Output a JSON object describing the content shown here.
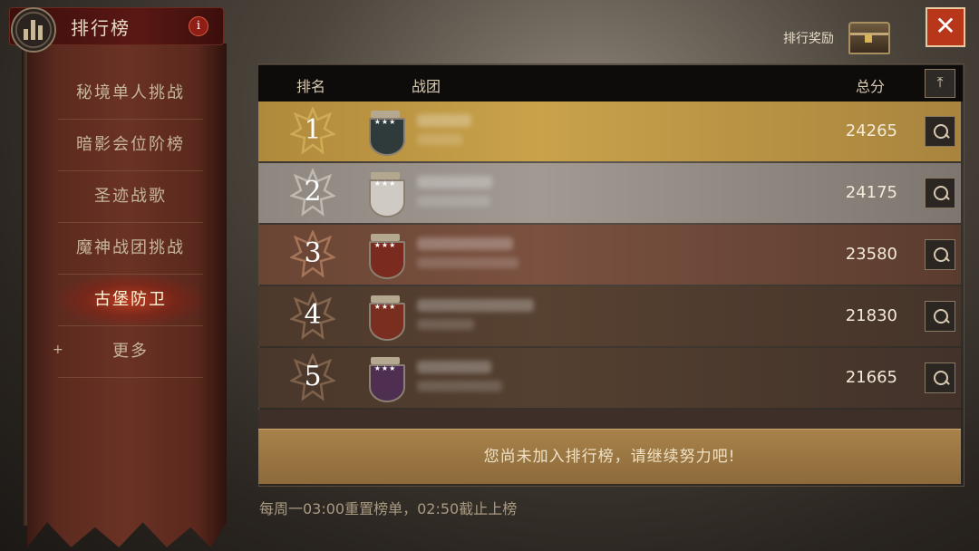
{
  "header": {
    "title": "排行榜",
    "info_icon": "i"
  },
  "sidebar": {
    "items": [
      {
        "label": "秘境单人挑战",
        "active": false
      },
      {
        "label": "暗影会位阶榜",
        "active": false
      },
      {
        "label": "圣迹战歌",
        "active": false
      },
      {
        "label": "魔神战团挑战",
        "active": false
      },
      {
        "label": "古堡防卫",
        "active": true
      },
      {
        "label": "更多",
        "active": false
      }
    ],
    "more_icon": "+"
  },
  "rewards": {
    "label": "排行奖励"
  },
  "close_icon": "✕",
  "table": {
    "columns": {
      "rank": "排名",
      "team": "战团",
      "score": "总分"
    },
    "top_icon": "⤒",
    "rows": [
      {
        "rank": "1",
        "score": "24265",
        "stars": "★★★",
        "row_bg": "linear-gradient(90deg,#b08a3c,#c9a24a 40%,#a8843e)",
        "emblem": "#e3c46a",
        "shield": "#2f3b3a"
      },
      {
        "rank": "2",
        "score": "24175",
        "stars": "★★★",
        "row_bg": "linear-gradient(90deg,#8e8780,#a19a92 40%,#7d766f)",
        "emblem": "#e6e0d6",
        "shield": "#cfcac4"
      },
      {
        "rank": "3",
        "score": "23580",
        "stars": "★★★",
        "row_bg": "linear-gradient(90deg,#6a4534,#7b5140 40%,#5a3c2e)",
        "emblem": "#d69a72",
        "shield": "#7a2a1e"
      },
      {
        "rank": "4",
        "score": "21830",
        "stars": "★★★",
        "row_bg": "linear-gradient(90deg,#4d392c,#574131 40%,#45342a)",
        "emblem": "#b08868",
        "shield": "#7a2e20"
      },
      {
        "rank": "5",
        "score": "21665",
        "stars": "★★★",
        "row_bg": "linear-gradient(90deg,#4a372b,#544030 40%,#42322a)",
        "emblem": "#a98466",
        "shield": "#4e2f52"
      }
    ]
  },
  "notice": "您尚未加入排行榜，请继续努力吧!",
  "footer": "每周一03:00重置榜单，02:50截止上榜"
}
